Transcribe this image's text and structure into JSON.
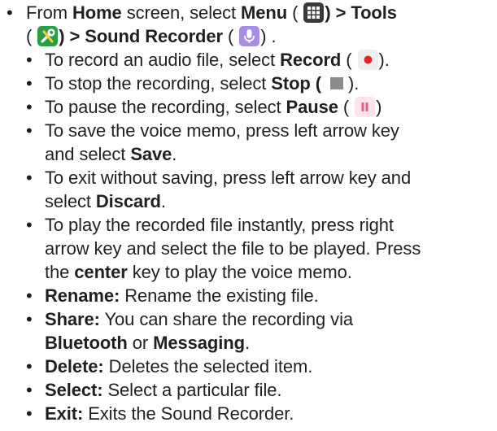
{
  "main": {
    "intro": {
      "from": "From ",
      "home": "Home",
      "screen_select": " screen, select ",
      "menu": "Menu",
      "open_paren": " (",
      "close_gt": ") >",
      "tools": " Tools",
      "paren_l": "(",
      "close_gt2": ") >",
      "sound_recorder": " Sound Recorder",
      "paren_l2": " (",
      "close_dot": ") ."
    },
    "items": [
      {
        "pre": "To record an audio file, select ",
        "bold": "Record",
        "post1": " (",
        "post2": ")."
      },
      {
        "pre": "To stop the recording, select ",
        "bold": "Stop",
        "post1": " (",
        "post2": ")."
      },
      {
        "pre": "To pause the recording, select ",
        "bold": "Pause",
        "post1": " (",
        "post2": ")"
      },
      {
        "line1": "To save the voice memo, press left arrow key",
        "line2_pre": "and select ",
        "line2_bold": "Save",
        "line2_post": "."
      },
      {
        "line1": "To exit without saving, press left arrow key and",
        "line2_pre": "select ",
        "line2_bold": "Discard",
        "line2_post": "."
      },
      {
        "line1": "To play the recorded file instantly, press right",
        "line2": "arrow key and select the file to be played. Press",
        "line3_pre": "the ",
        "line3_bold": "center",
        "line3_post": " key to play the voice memo."
      },
      {
        "bold": "Rename:",
        "text": " Rename the existing file."
      },
      {
        "bold": "Share:",
        "text": " You can share the recording via",
        "line2_bold1": "Bluetooth",
        "line2_mid": " or ",
        "line2_bold2": "Messaging",
        "line2_post": "."
      },
      {
        "bold": "Delete:",
        "text": " Deletes the selected item."
      },
      {
        "bold": "Select:",
        "text": " Select a particular file."
      },
      {
        "bold": "Exit:",
        "text": " Exits the Sound Recorder."
      }
    ],
    "bullet_char": "•"
  },
  "icons": {
    "menu": "menu-grid-icon",
    "tools": "tools-icon",
    "sound_recorder": "microphone-icon",
    "record": "record-icon",
    "stop": "stop-icon",
    "pause": "pause-icon"
  },
  "colors": {
    "text": "#231f20",
    "menu_icon_bg": "#3a3a3a",
    "tools_icon_bg": "#2a9d47",
    "mic_icon_bg": "#a98be8",
    "record_red": "#e8202a",
    "stop_gray": "#8a8a8a",
    "pause_pink": "#e85a8c"
  }
}
